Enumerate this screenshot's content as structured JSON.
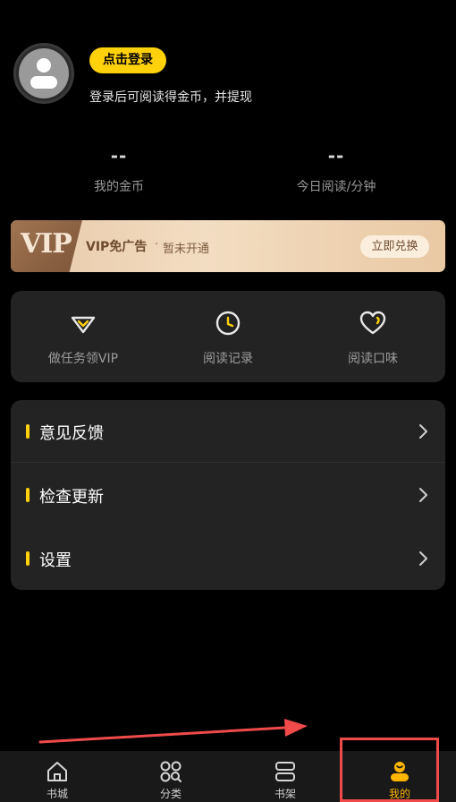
{
  "profile": {
    "login_button": "点击登录",
    "login_hint": "登录后可阅读得金币，并提现"
  },
  "stats": [
    {
      "value": "--",
      "label": "我的金币"
    },
    {
      "value": "--",
      "label": "今日阅读/分钟"
    }
  ],
  "vip_banner": {
    "badge": "VIP",
    "title": "VIP免广告",
    "separator": "·",
    "status": "暂未开通",
    "button": "立即兑换"
  },
  "quick_actions": [
    {
      "label": "做任务领VIP",
      "icon": "diamond-icon"
    },
    {
      "label": "阅读记录",
      "icon": "clock-icon"
    },
    {
      "label": "阅读口味",
      "icon": "heart-icon"
    }
  ],
  "menu": [
    {
      "label": "意见反馈"
    },
    {
      "label": "检查更新"
    },
    {
      "label": "设置"
    }
  ],
  "tabbar": {
    "items": [
      {
        "label": "书城",
        "icon": "home-icon",
        "active": false
      },
      {
        "label": "分类",
        "icon": "grid-search-icon",
        "active": false
      },
      {
        "label": "书架",
        "icon": "bookshelf-icon",
        "active": false
      },
      {
        "label": "我的",
        "icon": "profile-icon",
        "active": true
      }
    ]
  },
  "colors": {
    "accent": "#ffd10a",
    "active_tab": "#ffb400",
    "annotation": "#f04a4a",
    "card": "#232323",
    "background": "#000000"
  }
}
